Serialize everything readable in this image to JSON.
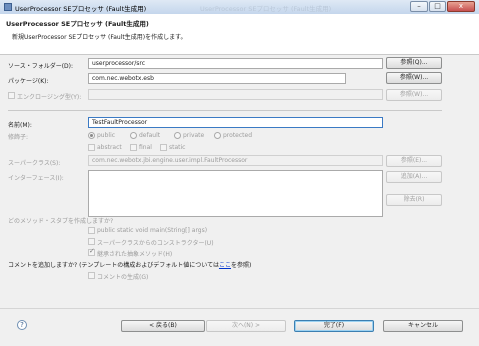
{
  "window": {
    "title": "UserProcessor SEプロセッサ (Fault生成用)",
    "ghost_title": "UserProcessor SEプロセッサ (Fault生成用)",
    "minimize": "–",
    "maximize": "□",
    "close": "x"
  },
  "banner": {
    "title": "UserProcessor SEプロセッサ (Fault生成用)",
    "description": "新規UserProcessor SEプロセッサ (Fault生成用)を作成します。"
  },
  "source_folder": {
    "label": "ソース・フォルダー(D):",
    "value": "userprocessor/src",
    "button": "参照(Q)..."
  },
  "package": {
    "label": "パッケージ(K):",
    "value": "com.nec.webotx.esb",
    "button": "参照(W)..."
  },
  "enclosing": {
    "label": "エンクロージング型(Y):",
    "value": "",
    "button": "参照(W)..."
  },
  "name": {
    "label": "名前(M):",
    "value": "TestFaultProcessor"
  },
  "modifiers": {
    "label": "修飾子:",
    "radios": [
      "public",
      "default",
      "private",
      "protected"
    ],
    "checks": [
      "abstract",
      "final",
      "static"
    ]
  },
  "superclass": {
    "label": "スーパークラス(S):",
    "value": "com.nec.webotx.jbi.engine.user.impl.FaultProcessor",
    "button": "参照(E)..."
  },
  "interfaces": {
    "label": "インターフェース(I):",
    "add_button": "追加(A)...",
    "remove_button": "除去(R)"
  },
  "stubs": {
    "question": "どのメソッド・スタブを作成しますか?",
    "items": [
      "public static void main(String[] args)",
      "スーパークラスからのコンストラクター(U)",
      "継承された抽象メソッド(H)"
    ]
  },
  "comments": {
    "question_prefix": "コメントを追加しますか? (テンプレートの構成およびデフォルト値については",
    "link": "ここ",
    "question_suffix": "を参照)",
    "checkbox": "コメントの生成(G)"
  },
  "footer": {
    "help": "?",
    "back": "< 戻る(B)",
    "next": "次へ(N) >",
    "finish": "完了(F)",
    "cancel": "キャンセル"
  }
}
